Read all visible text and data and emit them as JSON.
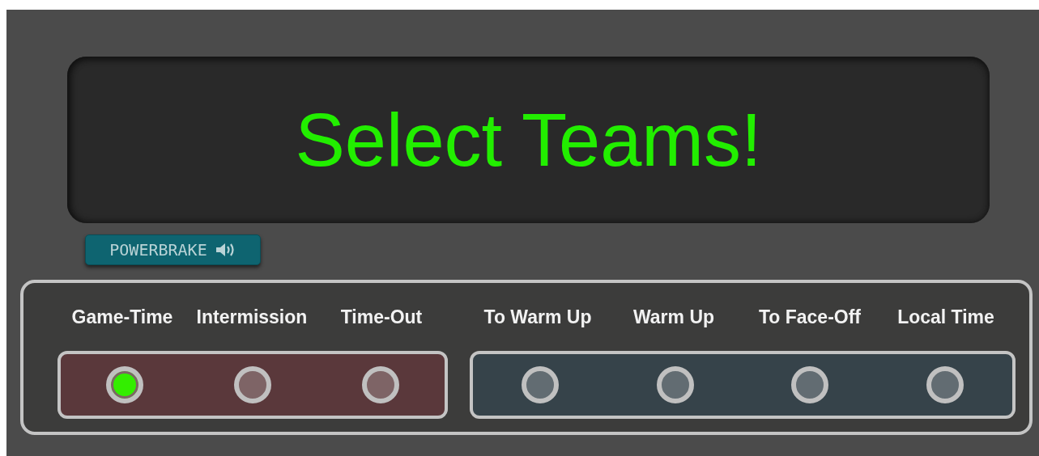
{
  "display": {
    "message": "Select Teams!"
  },
  "powerbrake_button": {
    "label": "POWERBRAKE"
  },
  "mode_groups": [
    {
      "color": "#5a383b",
      "modes": [
        {
          "label": "Game-Time",
          "selected": true
        },
        {
          "label": "Intermission",
          "selected": false
        },
        {
          "label": "Time-Out",
          "selected": false
        }
      ]
    },
    {
      "color": "#36434a",
      "modes": [
        {
          "label": "To Warm Up",
          "selected": false
        },
        {
          "label": "Warm Up",
          "selected": false
        },
        {
          "label": "To Face-Off",
          "selected": false
        },
        {
          "label": "Local Time",
          "selected": false
        }
      ]
    }
  ]
}
